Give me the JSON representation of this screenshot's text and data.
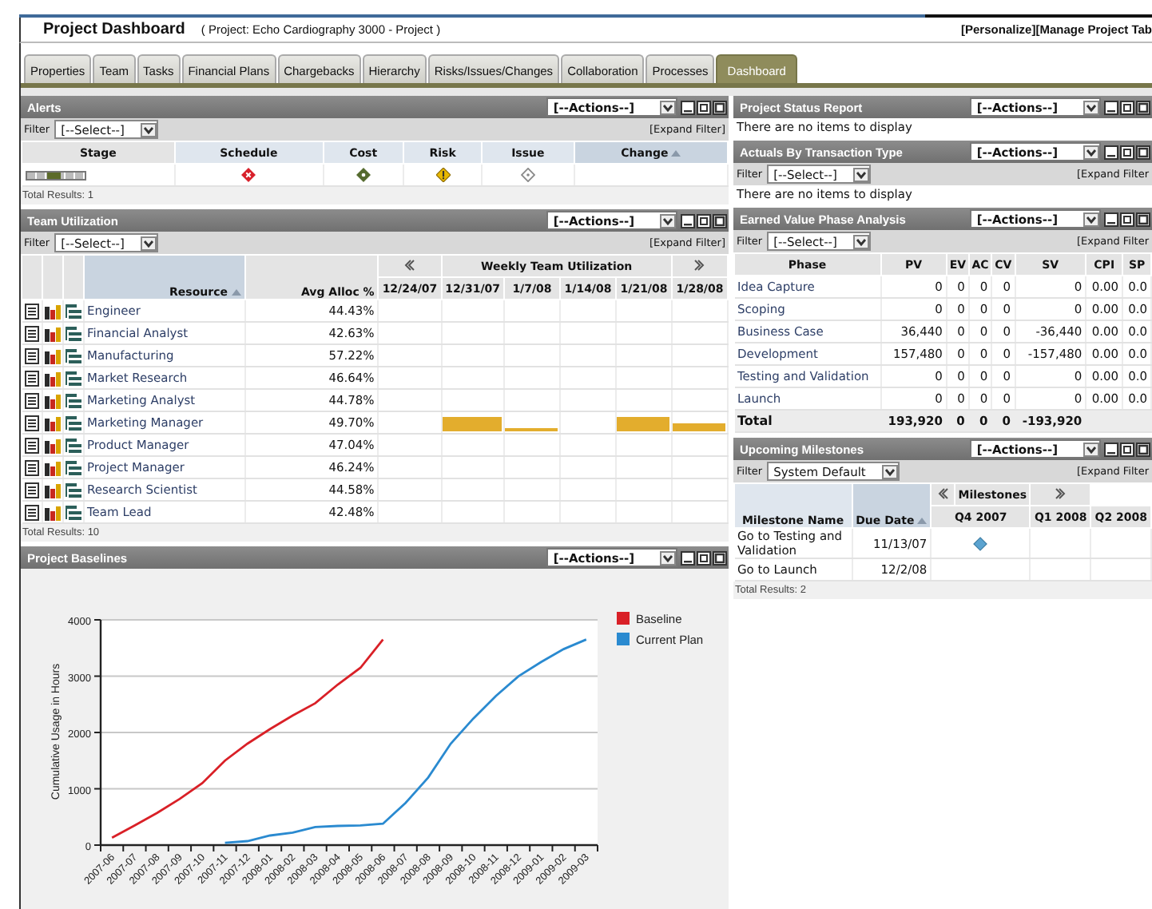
{
  "header": {
    "title": "Project Dashboard",
    "subtitle": "( Project: Echo Cardiography 3000 - Project )",
    "links": [
      "[Personalize]",
      "[Manage Project Tab"
    ]
  },
  "tabs": [
    {
      "label": "Properties",
      "selected": false
    },
    {
      "label": "Team",
      "selected": false
    },
    {
      "label": "Tasks",
      "selected": false
    },
    {
      "label": "Financial Plans",
      "selected": false
    },
    {
      "label": "Chargebacks",
      "selected": false
    },
    {
      "label": "Hierarchy",
      "selected": false
    },
    {
      "label": "Risks/Issues/Changes",
      "selected": false
    },
    {
      "label": "Collaboration",
      "selected": false
    },
    {
      "label": "Processes",
      "selected": false
    },
    {
      "label": "Dashboard",
      "selected": true
    }
  ],
  "alerts": {
    "title": "Alerts",
    "actions": "[--Actions--]",
    "filter_label": "Filter",
    "filter_value": "[--Select--]",
    "expand": "[Expand Filter]",
    "columns": [
      {
        "label": "Stage",
        "sorted": false
      },
      {
        "label": "Schedule",
        "sorted": false
      },
      {
        "label": "Cost",
        "sorted": false
      },
      {
        "label": "Risk",
        "sorted": false
      },
      {
        "label": "Issue",
        "sorted": false
      },
      {
        "label": "Change",
        "sorted": true
      }
    ],
    "row": {
      "stage": {
        "level": 0.6
      },
      "statuses": [
        {
          "kind": "critical"
        },
        {
          "kind": "ok"
        },
        {
          "kind": "warning"
        },
        {
          "kind": "empty"
        }
      ]
    },
    "total": "Total Results: 1"
  },
  "team": {
    "title": "Team Utilization",
    "actions": "[--Actions--]",
    "filter_label": "Filter",
    "filter_value": "[--Select--]",
    "expand": "[Expand Filter]",
    "col_resource": "Resource",
    "col_avg": "Avg Alloc %",
    "weekly_title": "Weekly Team Utilization",
    "weeks": [
      "12/24/07",
      "12/31/07",
      "1/7/08",
      "1/14/08",
      "1/21/08",
      "1/28/08"
    ],
    "rows": [
      {
        "name": "Engineer",
        "avg": "44.43%"
      },
      {
        "name": "Financial Analyst",
        "avg": "42.63%"
      },
      {
        "name": "Manufacturing",
        "avg": "57.22%"
      },
      {
        "name": "Market Research",
        "avg": "46.64%"
      },
      {
        "name": "Marketing Analyst",
        "avg": "44.78%"
      },
      {
        "name": "Marketing Manager",
        "avg": "49.70%",
        "util": [
          {
            "kind": "none"
          },
          {
            "kind": "high"
          },
          {
            "kind": "low"
          },
          {
            "kind": "none"
          },
          {
            "kind": "high"
          },
          {
            "kind": "medium"
          }
        ]
      },
      {
        "name": "Product Manager",
        "avg": "47.04%"
      },
      {
        "name": "Project Manager",
        "avg": "46.24%"
      },
      {
        "name": "Research Scientist",
        "avg": "44.58%"
      },
      {
        "name": "Team Lead",
        "avg": "42.48%"
      }
    ],
    "total": "Total Results: 10"
  },
  "baselines": {
    "title": "Project Baselines",
    "actions": "[--Actions--]",
    "chart_data": {
      "type": "line",
      "ylabel": "Cumulative Usage in Hours",
      "categories": [
        "2007-06",
        "2007-07",
        "2007-08",
        "2007-09",
        "2007-10",
        "2007-11",
        "2007-12",
        "2008-01",
        "2008-02",
        "2008-03",
        "2008-04",
        "2008-05",
        "2008-06",
        "2008-07",
        "2008-08",
        "2008-09",
        "2008-10",
        "2008-11",
        "2008-12",
        "2009-01",
        "2009-02",
        "2009-03"
      ],
      "ylim": [
        0,
        4000
      ],
      "grid": true,
      "legend": "right",
      "yticks": [
        0,
        1000,
        2000,
        3000,
        4000
      ],
      "series": [
        {
          "name": "Baseline",
          "color": "#d92027",
          "values": [
            130,
            350,
            570,
            820,
            1100,
            1500,
            1800,
            2060,
            2300,
            2520,
            2850,
            3150,
            3650,
            null,
            null,
            null,
            null,
            null,
            null,
            null,
            null,
            null
          ]
        },
        {
          "name": "Current Plan",
          "color": "#2a8ad0",
          "values": [
            null,
            null,
            null,
            null,
            null,
            40,
            70,
            170,
            220,
            320,
            340,
            350,
            380,
            750,
            1200,
            1800,
            2250,
            2650,
            3000,
            3250,
            3480,
            3650
          ]
        }
      ]
    }
  },
  "status_report": {
    "title": "Project Status Report",
    "actions": "[--Actions--]",
    "message": "There are no items to display"
  },
  "actuals": {
    "title": "Actuals By Transaction Type",
    "actions": "[--Actions--]",
    "filter_label": "Filter",
    "filter_value": "[--Select--]",
    "expand": "[Expand Filter",
    "message": "There are no items to display"
  },
  "earned": {
    "title": "Earned Value Phase Analysis",
    "actions": "[--Actions--]",
    "filter_label": "Filter",
    "filter_value": "[--Select--]",
    "expand": "[Expand Filter",
    "columns": [
      "Phase",
      "PV",
      "EV",
      "AC",
      "CV",
      "SV",
      "CPI",
      "SP"
    ],
    "rows": [
      [
        "Idea Capture",
        "0",
        "0",
        "0",
        "0",
        "0",
        "0.00",
        "0.0"
      ],
      [
        "Scoping",
        "0",
        "0",
        "0",
        "0",
        "0",
        "0.00",
        "0.0"
      ],
      [
        "Business Case",
        "36,440",
        "0",
        "0",
        "0",
        "-36,440",
        "0.00",
        "0.0"
      ],
      [
        "Development",
        "157,480",
        "0",
        "0",
        "0",
        "-157,480",
        "0.00",
        "0.0"
      ],
      [
        "Testing and Validation",
        "0",
        "0",
        "0",
        "0",
        "0",
        "0.00",
        "0.0"
      ],
      [
        "Launch",
        "0",
        "0",
        "0",
        "0",
        "0",
        "0.00",
        "0.0"
      ]
    ],
    "total": [
      "Total",
      "193,920",
      "0",
      "0",
      "0",
      "-193,920"
    ]
  },
  "milestones": {
    "title": "Upcoming Milestones",
    "actions": "[--Actions--]",
    "filter_label": "Filter",
    "filter_value": "System Default",
    "expand": "[Expand Filter",
    "col_name": "Milestone Name",
    "col_due": "Due Date",
    "group_title": "Milestones",
    "quarters": [
      "Q4 2007",
      "Q1 2008",
      "Q2 2008"
    ],
    "rows": [
      {
        "name": "Go to Testing and Validation",
        "due": "11/13/07",
        "markers": [
          true,
          false,
          false
        ]
      },
      {
        "name": "Go to Launch",
        "due": "12/2/08",
        "markers": [
          false,
          false,
          false
        ]
      }
    ],
    "total": "Total Results: 2"
  }
}
